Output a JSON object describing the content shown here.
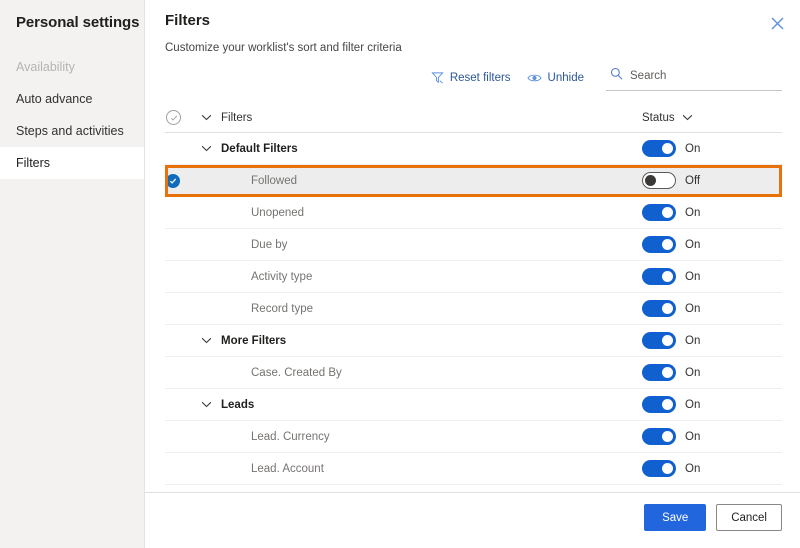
{
  "sidebar": {
    "title": "Personal settings",
    "items": [
      {
        "label": "Availability",
        "state": "disabled"
      },
      {
        "label": "Auto advance",
        "state": "normal"
      },
      {
        "label": "Steps and activities",
        "state": "normal"
      },
      {
        "label": "Filters",
        "state": "selected"
      }
    ]
  },
  "panel": {
    "title": "Filters",
    "subtitle": "Customize your worklist's sort and filter criteria",
    "close_label": "Close"
  },
  "commandbar": {
    "reset_filters_label": "Reset filters",
    "unhide_label": "Unhide",
    "search_placeholder": "Search",
    "search_value": ""
  },
  "table": {
    "headers": {
      "name": "Filters",
      "status": "Status"
    },
    "rows": [
      {
        "name": "Default Filters",
        "level": "group",
        "status_label": "On",
        "status_on": true,
        "selected": false
      },
      {
        "name": "Followed",
        "level": "child",
        "status_label": "Off",
        "status_on": false,
        "selected": true
      },
      {
        "name": "Unopened",
        "level": "child",
        "status_label": "On",
        "status_on": true,
        "selected": false
      },
      {
        "name": "Due by",
        "level": "child",
        "status_label": "On",
        "status_on": true,
        "selected": false
      },
      {
        "name": "Activity type",
        "level": "child",
        "status_label": "On",
        "status_on": true,
        "selected": false
      },
      {
        "name": "Record type",
        "level": "child",
        "status_label": "On",
        "status_on": true,
        "selected": false
      },
      {
        "name": "More Filters",
        "level": "group",
        "status_label": "On",
        "status_on": true,
        "selected": false
      },
      {
        "name": "Case. Created By",
        "level": "child",
        "status_label": "On",
        "status_on": true,
        "selected": false
      },
      {
        "name": "Leads",
        "level": "group",
        "status_label": "On",
        "status_on": true,
        "selected": false
      },
      {
        "name": "Lead. Currency",
        "level": "child",
        "status_label": "On",
        "status_on": true,
        "selected": false
      },
      {
        "name": "Lead. Account",
        "level": "child",
        "status_label": "On",
        "status_on": true,
        "selected": false
      }
    ]
  },
  "footer": {
    "save_label": "Save",
    "cancel_label": "Cancel"
  },
  "colors": {
    "accent_blue": "#2266dd",
    "link_blue": "#2b579a",
    "toggle_on": "#1060d0",
    "highlight_orange": "#e8710a",
    "sidebar_bg": "#f3f2f1",
    "selected_row_bg": "#ededed"
  }
}
